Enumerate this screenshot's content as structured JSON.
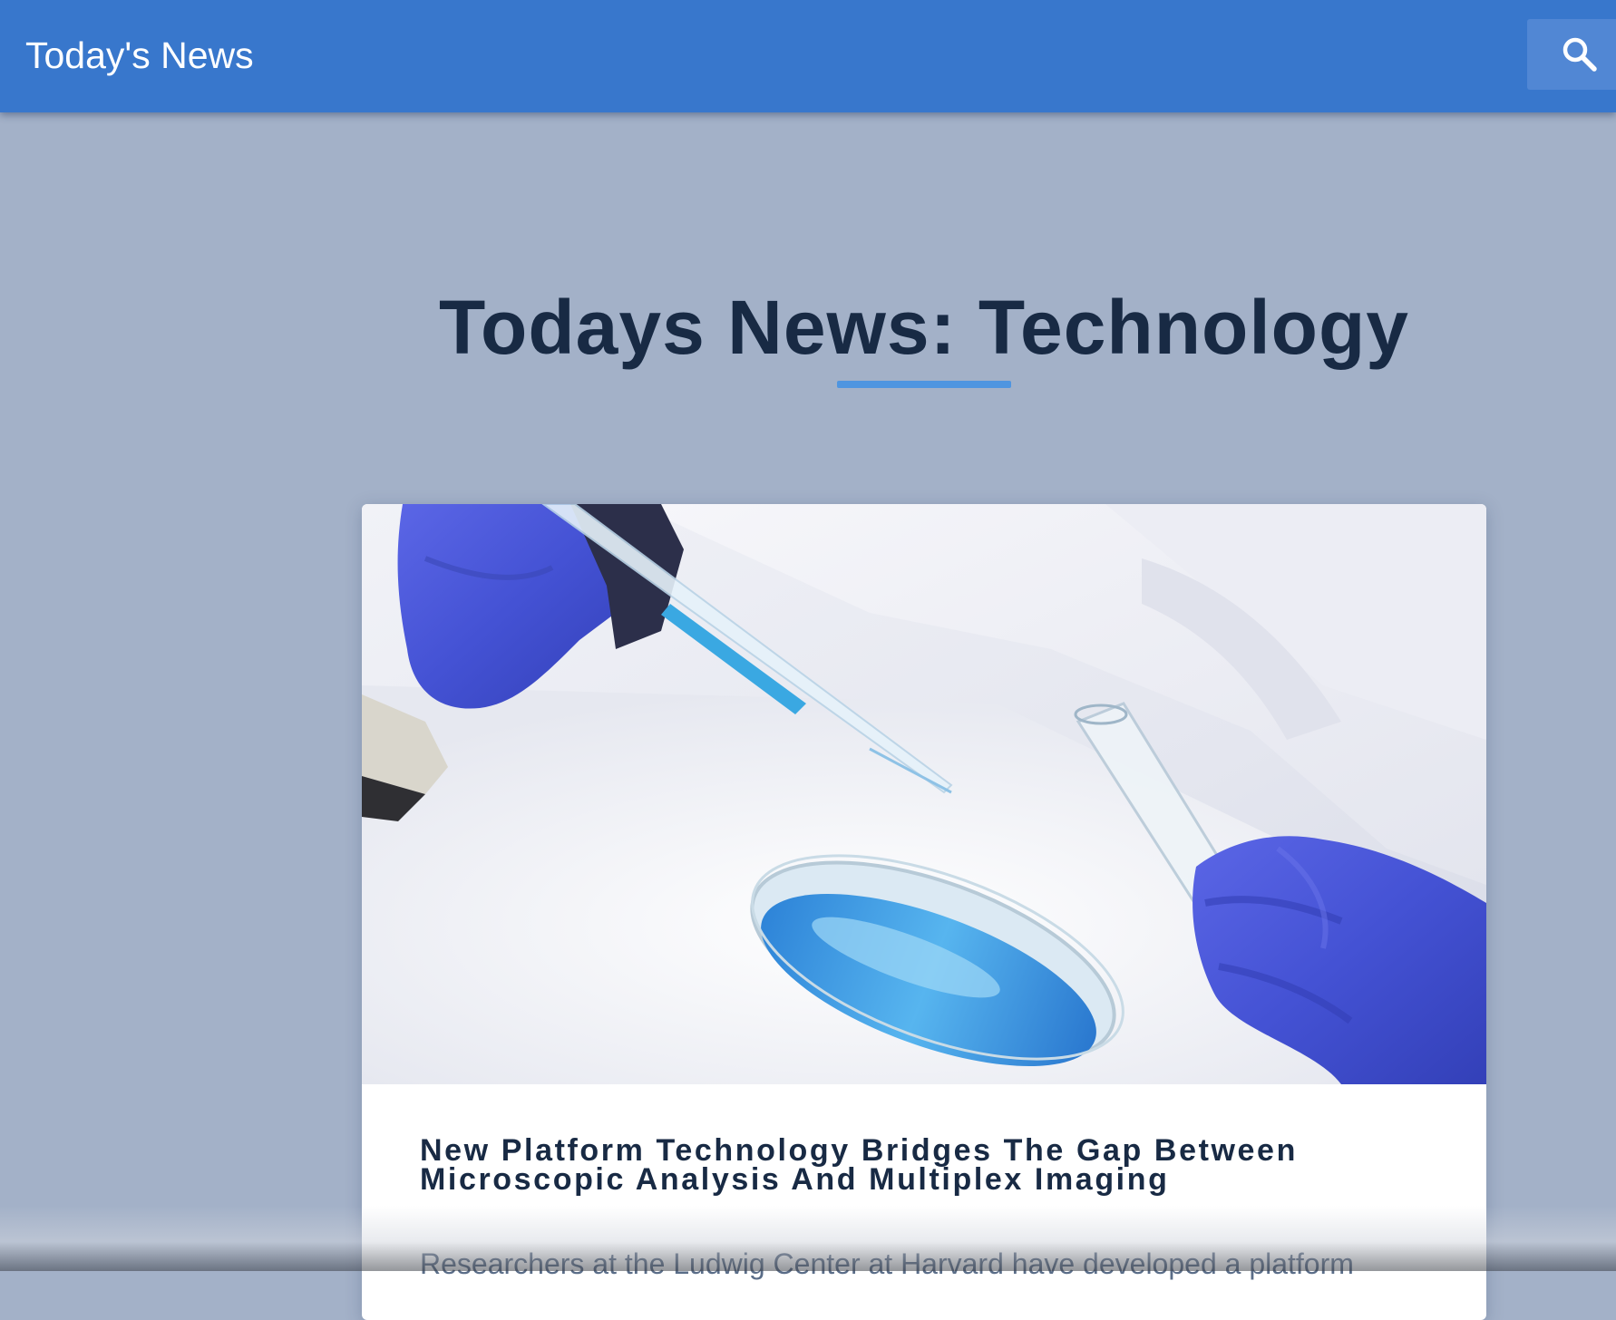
{
  "header": {
    "brand": "Today's News",
    "search_icon": "search-icon"
  },
  "main": {
    "page_title": "Todays News: Technology",
    "article": {
      "image_icon": "lab-photo",
      "headline": "New Platform Technology Bridges The Gap Between Microscopic Analysis And Multiplex Imaging",
      "excerpt": "Researchers at the Ludwig Center at Harvard have developed a platform"
    }
  },
  "colors": {
    "header_bg": "#3877cc",
    "page_bg": "#a3b1c8",
    "title_text": "#182a44",
    "accent_rule": "#4f95e0",
    "excerpt_text": "#5a6d88"
  }
}
